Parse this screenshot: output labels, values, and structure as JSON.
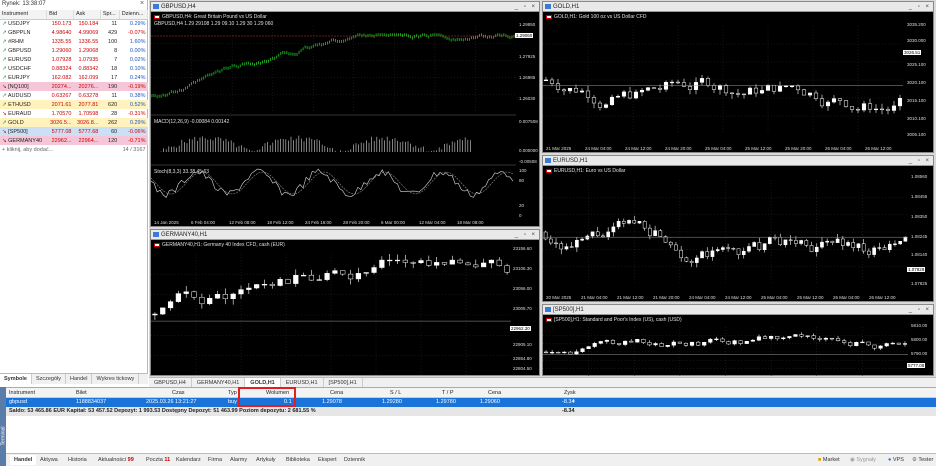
{
  "market_watch": {
    "title": "Rynek: 13:38:07",
    "columns": [
      "Instrument",
      "Bid",
      "Ask",
      "Spr...",
      "Dzienn..."
    ],
    "rows": [
      {
        "symbol": "USDJPY",
        "bid": "150.173",
        "ask": "150.184",
        "spread": "11",
        "daily": "0.29%",
        "trend": "up",
        "highlight": ""
      },
      {
        "symbol": "GBPPLN",
        "bid": "4.98640",
        "ask": "4.99069",
        "spread": "429",
        "daily": "-0.07%",
        "trend": "up",
        "highlight": ""
      },
      {
        "symbol": "#RHM",
        "bid": "1335.55",
        "ask": "1336.55",
        "spread": "100",
        "daily": "1.60%",
        "trend": "up",
        "highlight": ""
      },
      {
        "symbol": "GBPUSD",
        "bid": "1.29060",
        "ask": "1.29068",
        "spread": "8",
        "daily": "0.00%",
        "trend": "up",
        "highlight": ""
      },
      {
        "symbol": "EURUSD",
        "bid": "1.07928",
        "ask": "1.07935",
        "spread": "7",
        "daily": "0.02%",
        "trend": "up",
        "highlight": ""
      },
      {
        "symbol": "USDCHF",
        "bid": "0.88324",
        "ask": "0.88342",
        "spread": "18",
        "daily": "0.10%",
        "trend": "up",
        "highlight": ""
      },
      {
        "symbol": "EURJPY",
        "bid": "162.082",
        "ask": "162.099",
        "spread": "17",
        "daily": "0.24%",
        "trend": "up",
        "highlight": ""
      },
      {
        "symbol": "[NQ100]",
        "bid": "20274...",
        "ask": "20276...",
        "spread": "190",
        "daily": "-0.19%",
        "trend": "down",
        "highlight": "pink"
      },
      {
        "symbol": "AUDUSD",
        "bid": "0.63267",
        "ask": "0.63278",
        "spread": "11",
        "daily": "0.38%",
        "trend": "up",
        "highlight": ""
      },
      {
        "symbol": "ETHUSD",
        "bid": "2071.61",
        "ask": "2077.81",
        "spread": "620",
        "daily": "0.52%",
        "trend": "up",
        "highlight": "yellow"
      },
      {
        "symbol": "EURAUD",
        "bid": "1.70570",
        "ask": "1.70598",
        "spread": "28",
        "daily": "-0.31%",
        "trend": "down",
        "highlight": ""
      },
      {
        "symbol": "GOLD",
        "bid": "3026.5...",
        "ask": "3026.8...",
        "spread": "262",
        "daily": "0.29%",
        "trend": "up",
        "highlight": "yellow"
      },
      {
        "symbol": "[SP500]",
        "bid": "5777.08",
        "ask": "5777.68",
        "spread": "60",
        "daily": "-0.06%",
        "trend": "down",
        "highlight": "blue"
      },
      {
        "symbol": "GERMANY40",
        "bid": "22962...",
        "ask": "22964...",
        "spread": "120",
        "daily": "-0.71%",
        "trend": "down",
        "highlight": "pink"
      }
    ],
    "add_row": {
      "label": "+ kliknij, aby dodać...",
      "count": "14 / 3167"
    },
    "tabs": [
      "Symbole",
      "Szczegóły",
      "Handel",
      "Wykres tickowy"
    ]
  },
  "charts": [
    {
      "id": "gbpusd",
      "window_title": "GBPUSD,H4",
      "info": "GBPUSD,H4: Great Britain Pound vs US Dollar",
      "ohlc_line": "GBPUSD,H4 1.29 29108 1.29 09.10 1.29 30 1.29 060",
      "macd_label": "MACD(12,26,9) -0.00084 0.00142",
      "stoch_label": "Stoch(8,3,3) 33.38 45.63",
      "y_labels": [
        "1.29850",
        "1.29060",
        "1.27925",
        "1.26985",
        "1.26030",
        "0.007508",
        "0.000000",
        "-0.00508",
        "100",
        "80",
        "20",
        "0"
      ],
      "x_labels": [
        "14 Jan 2025",
        "6 Feb 04:00",
        "12 Feb 08:00",
        "18 Feb 12:00",
        "24 Feb 16:00",
        "28 Feb 20:00",
        "6 Mar 00:00",
        "12 Mar 04:00",
        "18 Mar 08:00",
        "21 Mar 04:00"
      ]
    },
    {
      "id": "gold",
      "window_title": "GOLD,H1",
      "info": "GOLD,H1: Gold 100 oz vs US Dollar CFD",
      "y_labels": [
        "3035.200",
        "3030.000",
        "3026.51",
        "3025.100",
        "3020.100",
        "3015.100",
        "3010.100",
        "3005.100"
      ],
      "x_labels": [
        "21 Mar 2025",
        "24 Mar 04:00",
        "24 Mar 12:00",
        "24 Mar 20:00",
        "25 Mar 04:00",
        "25 Mar 12:00",
        "25 Mar 20:00",
        "26 Mar 04:00",
        "26 Mar 12:00"
      ]
    },
    {
      "id": "eurusd",
      "window_title": "EURUSD,H1",
      "info": "EURUSD,H1: Euro vs US Dollar",
      "y_labels": [
        "1.08560",
        "1.08455",
        "1.08350",
        "1.08245",
        "1.08140",
        "1.07928",
        "1.07825"
      ],
      "x_labels": [
        "20 Mar 2025",
        "21 Mar 04:00",
        "21 Mar 12:00",
        "21 Mar 20:00",
        "24 Mar 04:00",
        "24 Mar 12:00",
        "25 Mar 04:00",
        "25 Mar 12:00",
        "26 Mar 04:00",
        "26 Mar 12:00"
      ]
    },
    {
      "id": "germany40",
      "window_title": "GERMANY40,H1",
      "info": "GERMANY40,H1: Germany 40 Index CFD, cash (EUR)",
      "y_labels": [
        "23156.60",
        "23106.30",
        "23056.00",
        "23005.70",
        "22962.30",
        "22905.10",
        "22854.80",
        "22804.50"
      ],
      "x_labels": []
    },
    {
      "id": "sp500",
      "window_title": "[SP500],H1",
      "info": "[SP500],H1: Standard and Poor's Index (US), cash (USD)",
      "y_labels": [
        "5810.00",
        "5800.00",
        "5790.00",
        "5777.08"
      ],
      "x_labels": []
    }
  ],
  "chart_tabs": [
    "GBPUSD,H4",
    "GERMANY40,H1",
    "GOLD,H1",
    "EURUSD,H1",
    "[SP500],H1"
  ],
  "active_chart_tab": "GOLD,H1",
  "terminal": {
    "columns": [
      "Instrument",
      "Bilet",
      "Czas",
      "Typ",
      "Wolumen",
      "Cena",
      "S / L",
      "T / P",
      "Cena",
      "Zysk"
    ],
    "position": {
      "symbol": "gbpusd",
      "ticket": "1188834037",
      "time": "2025.03.26 13:21:27",
      "type": "buy",
      "volume": "0.1",
      "price": "1.29078",
      "sl": "1.29280",
      "tp": "1.29780",
      "current_price": "1.29060",
      "profit": "-8.34"
    },
    "summary": {
      "text": "Saldo: 53 465.86 EUR  Kapitał: 53 457.52  Depozyt: 1 993.53  Dostępny Depozyt: 51 463.99  Poziom depozytu: 2 681.55 %",
      "profit": "-8.34"
    },
    "side_label": "Terminal"
  },
  "bottom_tabs": [
    {
      "label": "Handel",
      "badge": ""
    },
    {
      "label": "Aktywa",
      "badge": ""
    },
    {
      "label": "Historia",
      "badge": ""
    },
    {
      "label": "Aktualności",
      "badge": "99"
    },
    {
      "label": "Poczta",
      "badge": "11"
    },
    {
      "label": "Kalendarz",
      "badge": ""
    },
    {
      "label": "Firma",
      "badge": ""
    },
    {
      "label": "Alarmy",
      "badge": ""
    },
    {
      "label": "Artykuły",
      "badge": ""
    },
    {
      "label": "Biblioteka",
      "badge": ""
    },
    {
      "label": "Ekspert",
      "badge": ""
    },
    {
      "label": "Dziennik",
      "badge": ""
    }
  ],
  "status": {
    "market": "Market",
    "signals": "Sygnały",
    "vps": "VPS",
    "tester": "Tester"
  },
  "colors": {
    "bull": "#ffffff",
    "bear": "#000000",
    "line": "#22cc22",
    "highlight_box": "#e02020",
    "selected_row": "#1a73d9"
  }
}
